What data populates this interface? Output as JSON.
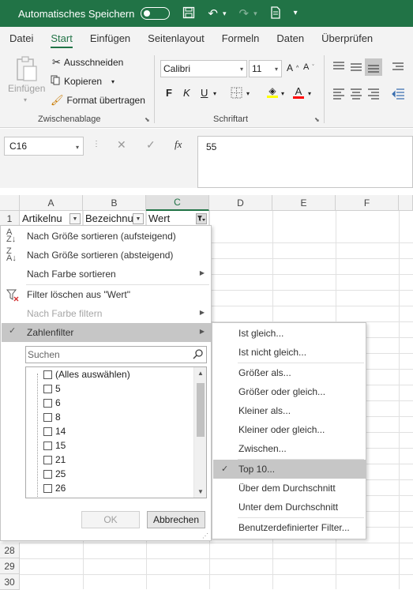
{
  "titlebar": {
    "autosave_label": "Automatisches Speichern",
    "icons": [
      "save-icon",
      "undo-icon",
      "redo-icon",
      "touch-mode-icon",
      "customize-icon"
    ]
  },
  "ribbon_tabs": [
    "Datei",
    "Start",
    "Einfügen",
    "Seitenlayout",
    "Formeln",
    "Daten",
    "Überprüfen"
  ],
  "active_tab": "Start",
  "clipboard": {
    "paste_label": "Einfügen",
    "cut_label": "Ausschneiden",
    "copy_label": "Kopieren",
    "format_painter_label": "Format übertragen",
    "group_label": "Zwischenablage"
  },
  "font": {
    "font_name": "Calibri",
    "font_size": "11",
    "bold": "F",
    "italic": "K",
    "underline": "U",
    "group_label": "Schriftart",
    "fill_color": "#ffff00",
    "font_color": "#ff0000"
  },
  "formula_bar": {
    "name_box": "C16",
    "content": "55"
  },
  "columns": [
    "A",
    "B",
    "C",
    "D",
    "E",
    "F"
  ],
  "header_row": {
    "row_number": "1",
    "a": "Artikelnu",
    "b": "Bezeichnu",
    "c": "Wert"
  },
  "bottom_rows": [
    "28",
    "29",
    "30"
  ],
  "filter_menu": {
    "sort_ascending": "Nach Größe sortieren (aufsteigend)",
    "sort_descending": "Nach Größe sortieren (absteigend)",
    "sort_by_color": "Nach Farbe sortieren",
    "clear_filter": "Filter löschen aus \"Wert\"",
    "filter_by_color": "Nach Farbe filtern",
    "number_filter": "Zahlenfilter",
    "search_placeholder": "Suchen",
    "values": [
      "(Alles auswählen)",
      "5",
      "6",
      "8",
      "14",
      "15",
      "21",
      "25",
      "26"
    ],
    "ok_label": "OK",
    "cancel_label": "Abbrechen"
  },
  "number_filter_submenu": {
    "items": [
      "Ist gleich...",
      "Ist nicht gleich...",
      "Größer als...",
      "Größer oder gleich...",
      "Kleiner als...",
      "Kleiner oder gleich...",
      "Zwischen...",
      "Top 10...",
      "Über dem Durchschnitt",
      "Unter dem Durchschnitt",
      "Benutzerdefinierter Filter..."
    ],
    "checked_item": "Top 10..."
  },
  "colors": {
    "excel_green": "#217346",
    "highlight": "#c6c6c6"
  }
}
